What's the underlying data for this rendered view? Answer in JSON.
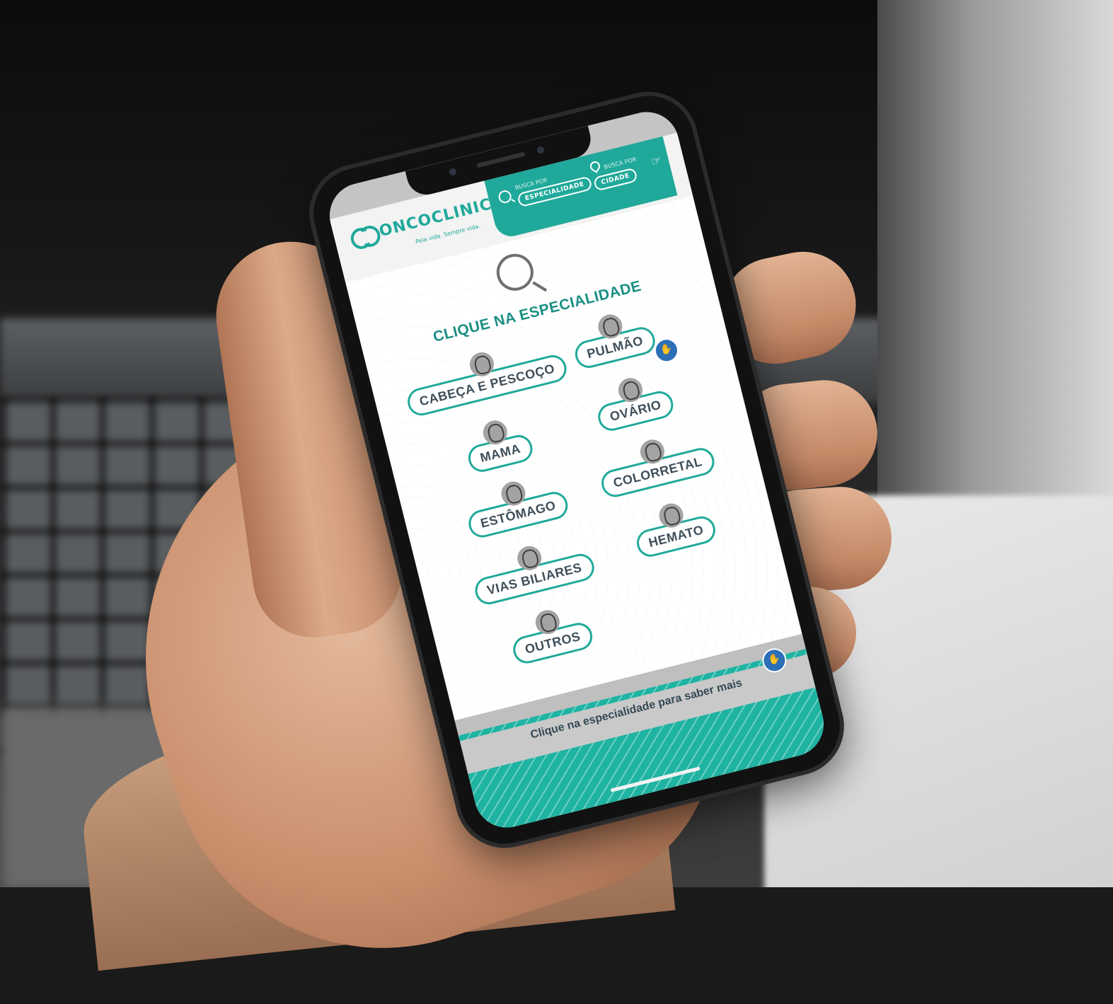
{
  "app": {
    "logo_text": "ONCOCLINICAS",
    "logo_tagline": "Pela vida. Sempre vida."
  },
  "header": {
    "search_label": "BUSCA POR",
    "search_button": "ESPECIALIDADE",
    "city_label": "BUSCA POR",
    "city_button": "CIDADE"
  },
  "main": {
    "heading": "CLIQUE NA ESPECIALIDADE",
    "specialties_left": [
      {
        "label": "CABEÇA E PESCOÇO",
        "icon": "head-icon"
      },
      {
        "label": "MAMA",
        "icon": "breast-icon"
      },
      {
        "label": "ESTÔMAGO",
        "icon": "stomach-icon"
      },
      {
        "label": "VIAS BILIARES",
        "icon": "liver-icon"
      },
      {
        "label": "OUTROS",
        "icon": "ribbon-icon"
      }
    ],
    "specialties_right": [
      {
        "label": "PULMÃO",
        "icon": "lungs-icon"
      },
      {
        "label": "OVÁRIO",
        "icon": "uterus-icon"
      },
      {
        "label": "COLORRETAL",
        "icon": "intestine-icon"
      },
      {
        "label": "HEMATO",
        "icon": "blood-drop-icon"
      }
    ]
  },
  "footer": {
    "text": "Clique na especialidade para saber mais"
  },
  "colors": {
    "accent": "#20a99a",
    "text": "#3f4f5a",
    "badge": "#2c6fb7"
  }
}
